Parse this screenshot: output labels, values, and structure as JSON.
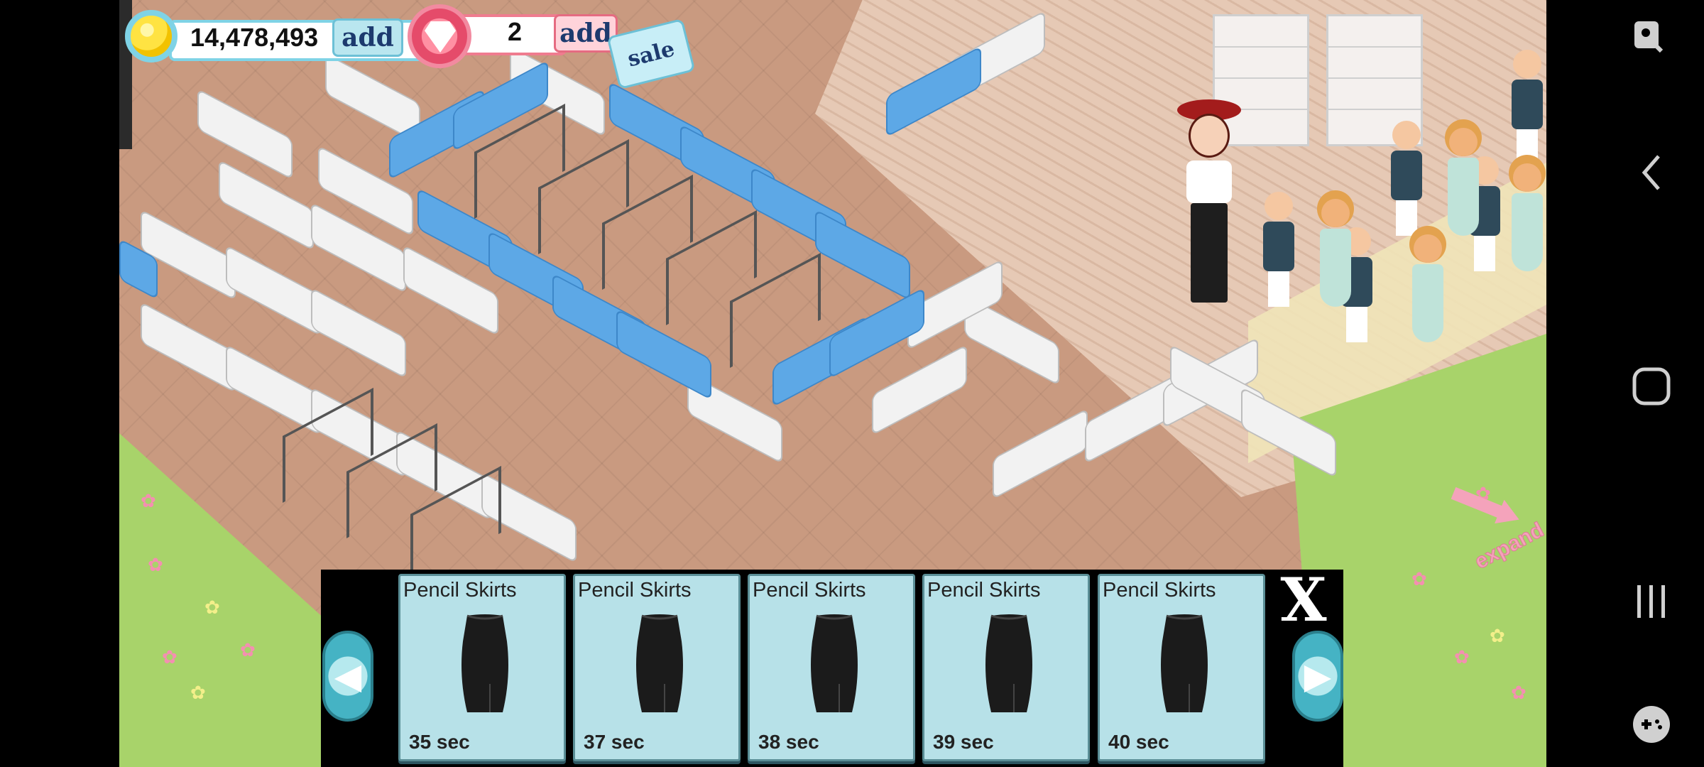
{
  "hud": {
    "coins": "14,478,493",
    "coin_add": "add",
    "gems": "2",
    "gem_add": "add",
    "sale": "sale"
  },
  "expand_label": "expand",
  "production": {
    "items": [
      {
        "name": "Pencil Skirts",
        "time": "35 sec"
      },
      {
        "name": "Pencil Skirts",
        "time": "37 sec"
      },
      {
        "name": "Pencil Skirts",
        "time": "38 sec"
      },
      {
        "name": "Pencil Skirts",
        "time": "39 sec"
      },
      {
        "name": "Pencil Skirts",
        "time": "40 sec"
      }
    ],
    "close_label": "X",
    "prev_icon": "chevron-left-icon",
    "next_icon": "chevron-right-icon"
  },
  "system_nav": {
    "icons": [
      "screenshot-edit-icon",
      "back-icon",
      "home-icon",
      "recents-icon",
      "game-tools-icon"
    ]
  },
  "colors": {
    "coin_accent": "#7fd3e6",
    "gem_accent": "#e54b6a",
    "card_bg": "#b7e1e8",
    "grass": "#a8d36a",
    "floor": "#c99a80"
  }
}
